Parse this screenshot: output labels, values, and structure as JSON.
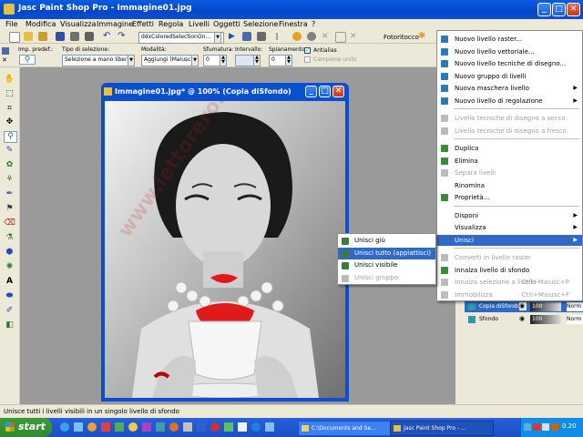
{
  "window": {
    "title": "Jasc Paint Shop Pro - Immagine01.jpg",
    "controls": [
      "_",
      "□",
      "✕"
    ]
  },
  "menubar": [
    "File",
    "Modifica",
    "Visualizza",
    "Immagine",
    "Effetti",
    "Regola",
    "Livelli",
    "Oggetti",
    "Selezione",
    "Finestra",
    "?"
  ],
  "toolbar": {
    "preset": "ddxColoredSelectionOn...",
    "fotoritocco": "Fotoritocco"
  },
  "tool_options": {
    "preset_label": "Imp. predef.:",
    "selection_type_label": "Tipo di selezione:",
    "selection_type_value": "Selezione a mano libera",
    "mode_label": "Modalità:",
    "mode_value": "Aggiungi (Maiusc)",
    "feather_label": "Sfumatura:",
    "feather_value": "0",
    "interval_label": "Intervallo:",
    "interval_value": "",
    "offset_label": "Spianamento:",
    "offset_value": "0",
    "antialias_label": "Antialias",
    "sample_label": "Campione unito"
  },
  "document": {
    "title": "Immagine01.jpg* @ 100% (Copia diSfondo)",
    "watermark": "www.lettoreroberto.it"
  },
  "layers_menu": {
    "items": [
      {
        "label": "Nuovo livello raster...",
        "enabled": true,
        "icon_color": "#2a7ab8"
      },
      {
        "label": "Nuovo livello vettoriale...",
        "enabled": true,
        "icon_color": "#2a7ab8"
      },
      {
        "label": "Nuovo livello tecniche di disegno...",
        "enabled": true,
        "icon_color": "#2a7ab8"
      },
      {
        "label": "Nuovo gruppo di livelli",
        "enabled": true,
        "icon_color": "#2a7ab8"
      },
      {
        "label": "Nuova maschera livello",
        "enabled": true,
        "submenu": true,
        "icon_color": "#2a7ab8"
      },
      {
        "label": "Nuovo livello di regolazione",
        "enabled": true,
        "submenu": true,
        "icon_color": "#2a7ab8"
      },
      {
        "label": "Livello tecniche di disegno a secco",
        "enabled": false,
        "icon_color": "#bbbbbb"
      },
      {
        "label": "Livello tecniche di disegno a fresco",
        "enabled": false,
        "icon_color": "#bbbbbb"
      },
      {
        "label": "Duplica",
        "enabled": true,
        "icon_color": "#3a8a3a"
      },
      {
        "label": "Elimina",
        "enabled": true,
        "icon_color": "#3a8a3a"
      },
      {
        "label": "Separa livelli",
        "enabled": false,
        "icon_color": "#bbbbbb"
      },
      {
        "label": "Rinomina",
        "enabled": true,
        "icon_color": ""
      },
      {
        "label": "Proprietà...",
        "enabled": true,
        "icon_color": "#3a8a3a"
      },
      {
        "label": "Disponi",
        "enabled": true,
        "submenu": true,
        "icon_color": ""
      },
      {
        "label": "Visualizza",
        "enabled": true,
        "submenu": true,
        "icon_color": ""
      },
      {
        "label": "Unisci",
        "enabled": true,
        "submenu": true,
        "highlighted": true,
        "icon_color": ""
      },
      {
        "label": "Converti in livello raster",
        "enabled": false,
        "icon_color": "#bbbbbb"
      },
      {
        "label": "Innalza livello di sfondo",
        "enabled": true,
        "icon_color": "#3a8a3a"
      },
      {
        "label": "Innalza selezione a livello",
        "enabled": false,
        "shortcut": "Ctrl+Maiusc+P",
        "icon_color": "#bbbbbb"
      },
      {
        "label": "Immobilizza",
        "enabled": false,
        "shortcut": "Ctrl+Maiusc+F",
        "icon_color": "#bbbbbb"
      }
    ]
  },
  "merge_submenu": {
    "items": [
      {
        "label": "Unisci giù",
        "enabled": true,
        "highlighted": false
      },
      {
        "label": "Unisci tutto (appiattisci)",
        "enabled": true,
        "highlighted": true
      },
      {
        "label": "Unisci visibile",
        "enabled": true,
        "highlighted": false
      },
      {
        "label": "Unisci gruppo",
        "enabled": false,
        "highlighted": false
      }
    ]
  },
  "layers_palette": {
    "rows": [
      {
        "name": "Copia diSfondo",
        "opacity": "100",
        "blend": "Norm"
      },
      {
        "name": "Sfondo",
        "opacity": "100",
        "blend": "Norm"
      }
    ]
  },
  "status": "Unisce tutti i livelli visibili in un singolo livello di sfondo",
  "taskbar": {
    "start": "start",
    "tasks": [
      "C:\\Documents and Se...",
      "Jasc Paint Shop Pro - ..."
    ],
    "clock": "0.20"
  },
  "colors": {
    "title_blue": "#0546c8",
    "menu_highlight": "#316ac5",
    "face": "#ece9d8",
    "taskbar": "#245edb"
  }
}
